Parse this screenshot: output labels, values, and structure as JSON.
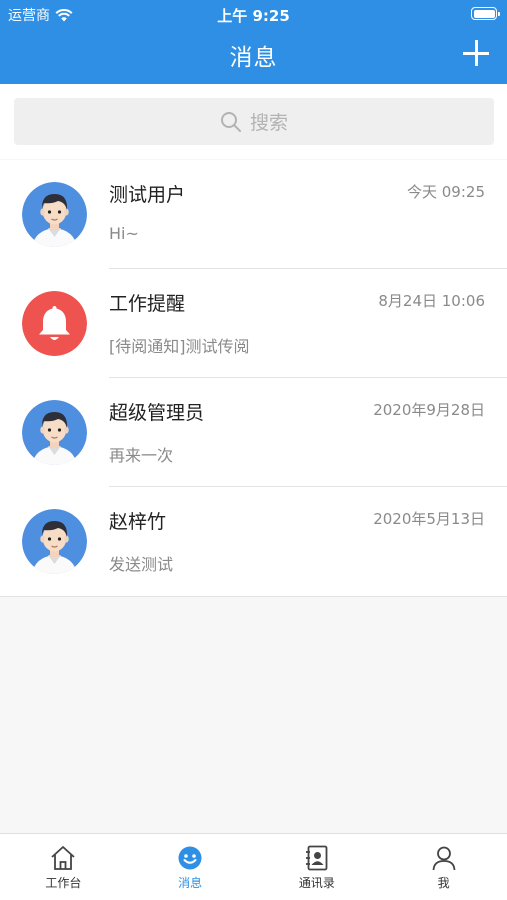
{
  "status_bar": {
    "carrier": "运营商",
    "time": "上午 9:25"
  },
  "nav": {
    "title": "消息"
  },
  "search": {
    "placeholder": "搜索"
  },
  "conversations": [
    {
      "name": "测试用户",
      "date": "今天 09:25",
      "preview": "Hi~",
      "avatar": "user-avatar"
    },
    {
      "name": "工作提醒",
      "date": "8月24日  10:06",
      "preview": "[待阅通知]测试传阅",
      "avatar": "bell-icon"
    },
    {
      "name": "超级管理员",
      "date": "2020年9月28日",
      "preview": "再来一次",
      "avatar": "user-avatar"
    },
    {
      "name": "赵梓竹",
      "date": "2020年5月13日",
      "preview": "发送测试",
      "avatar": "user-avatar"
    }
  ],
  "tabbar": {
    "items": [
      {
        "label": "工作台",
        "icon": "home-icon"
      },
      {
        "label": "消息",
        "icon": "message-icon",
        "active": true
      },
      {
        "label": "通讯录",
        "icon": "contacts-icon"
      },
      {
        "label": "我",
        "icon": "profile-icon"
      }
    ]
  },
  "colors": {
    "accent": "#2e8fe5",
    "bell_bg": "#ef5350"
  }
}
